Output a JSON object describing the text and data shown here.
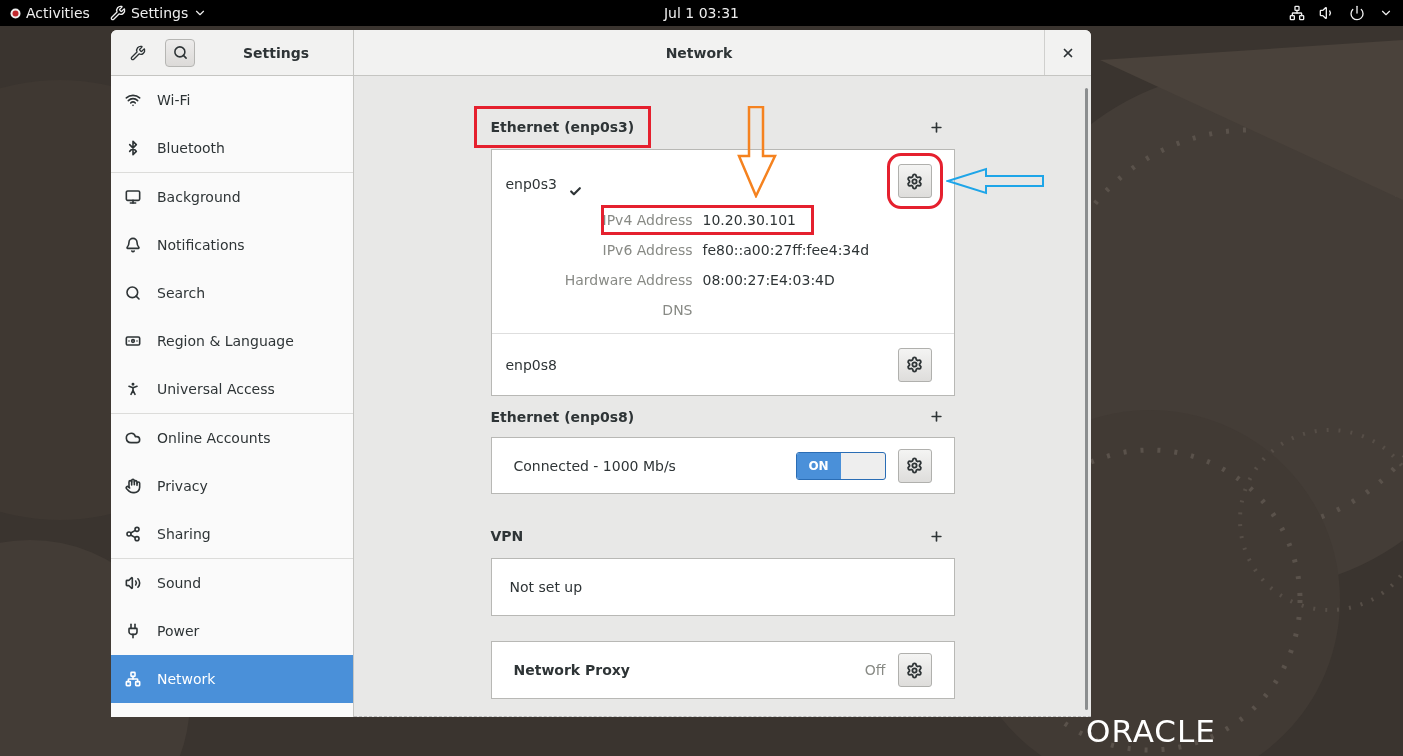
{
  "top_bar": {
    "activities": "Activities",
    "app_menu": "Settings",
    "clock": "Jul 1  03:31"
  },
  "window": {
    "sidebar_title": "Settings",
    "title": "Network"
  },
  "sidebar": {
    "groups": [
      {
        "items": [
          {
            "label": "Wi-Fi",
            "selected": false
          },
          {
            "label": "Bluetooth",
            "selected": false
          }
        ]
      },
      {
        "items": [
          {
            "label": "Background",
            "selected": false
          },
          {
            "label": "Notifications",
            "selected": false
          },
          {
            "label": "Search",
            "selected": false
          },
          {
            "label": "Region & Language",
            "selected": false
          },
          {
            "label": "Universal Access",
            "selected": false
          }
        ]
      },
      {
        "items": [
          {
            "label": "Online Accounts",
            "selected": false
          },
          {
            "label": "Privacy",
            "selected": false
          },
          {
            "label": "Sharing",
            "selected": false
          }
        ]
      },
      {
        "items": [
          {
            "label": "Sound",
            "selected": false
          },
          {
            "label": "Power",
            "selected": false
          },
          {
            "label": "Network",
            "selected": true
          }
        ]
      }
    ]
  },
  "sections": [
    {
      "kind": "devices",
      "title": "Ethernet (enp0s3)",
      "highlighted": true,
      "devices": [
        {
          "name": "enp0s3",
          "active": true,
          "gear_highlighted": true,
          "gear_arrow": true,
          "details": [
            {
              "label": "IPv4 Address",
              "value": "10.20.30.101",
              "highlighted": true,
              "arrow": true
            },
            {
              "label": "IPv6 Address",
              "value": "fe80::a00:27ff:fee4:34d",
              "highlighted": false
            },
            {
              "label": "Hardware Address",
              "value": "08:00:27:E4:03:4D",
              "highlighted": false
            },
            {
              "label": "DNS",
              "highlighted": false
            }
          ]
        },
        {
          "name": "enp0s8",
          "active": false,
          "gear_highlighted": false
        }
      ]
    },
    {
      "kind": "switch",
      "title": "Ethernet (enp0s8)",
      "highlighted": false,
      "status": "Connected - 1000 Mb/s",
      "switch": {
        "label": "ON",
        "on": true
      }
    },
    {
      "kind": "text",
      "title": "VPN",
      "highlighted": false,
      "text": "Not set up"
    },
    {
      "kind": "proxy",
      "label": "Network Proxy",
      "status": "Off"
    }
  ],
  "wallpaper_logo": "ORACLE"
}
